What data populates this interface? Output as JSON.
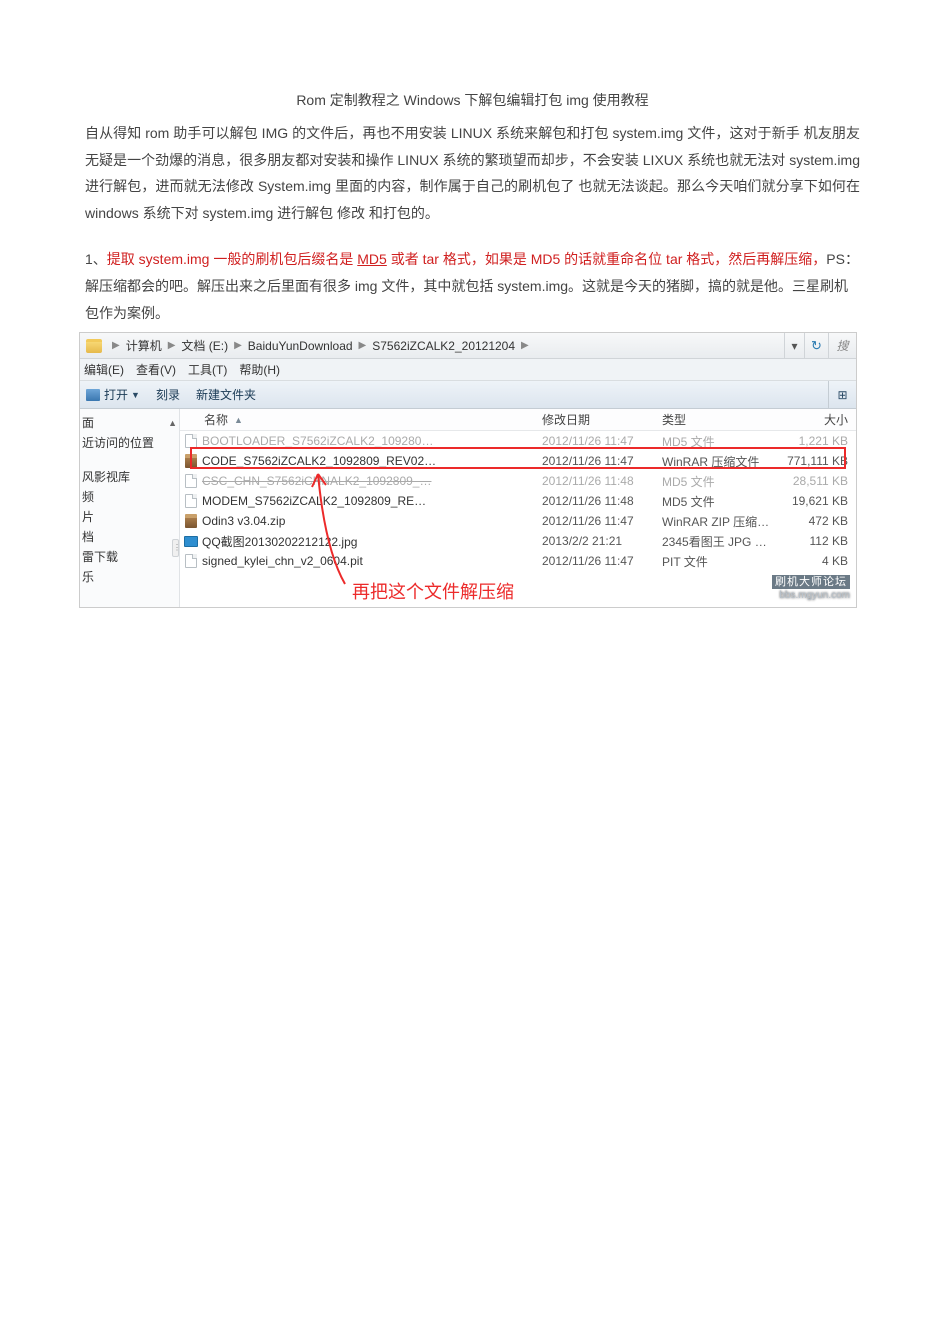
{
  "title": "Rom 定制教程之 Windows 下解包编辑打包 img 使用教程",
  "intro": "自从得知 rom 助手可以解包 IMG 的文件后，再也不用安装 LINUX 系统来解包和打包 system.img 文件，这对于新手 机友朋友无疑是一个劲爆的消息，很多朋友都对安装和操作 LINUX 系统的繁琐望而却步，不会安装 LIXUX 系统也就无法对 system.img 进行解包，进而就无法修改 System.img 里面的内容，制作属于自己的刷机包了 也就无法谈起。那么今天咱们就分享下如何在 windows 系统下对 system.img 进行解包 修改 和打包的。",
  "step1": {
    "prefix": "1、",
    "red_a": "提取 system.img 一般的刷机包后缀名是 ",
    "md5": "MD5",
    "red_b": " 或者 tar 格式，如果是 MD5 的话就重命名位 tar 格式，然后再解压缩，",
    "rest": "PS：解压缩都会的吧。解压出来之后里面有很多 img 文件，其中就包括 system.img。这就是今天的猪脚，搞的就是他。三星刷机包作为案例。"
  },
  "explorer": {
    "breadcrumbs": [
      "计算机",
      "文档 (E:)",
      "BaiduYunDownload",
      "S7562iZCALK2_20121204"
    ],
    "search_placeholder": "搜",
    "menu": {
      "edit": "编辑(E)",
      "view": "查看(V)",
      "tools": "工具(T)",
      "help": "帮助(H)"
    },
    "toolbar": {
      "open": "打开",
      "burn": "刻录",
      "newfolder": "新建文件夹",
      "view_glyph": "⊞"
    },
    "sidebar": {
      "top": "面",
      "recent": "近访问的位置",
      "items": [
        "风影视库",
        "频",
        "片",
        "档",
        "雷下载",
        "乐"
      ]
    },
    "columns": {
      "name": "名称",
      "date": "修改日期",
      "type": "类型",
      "size": "大小"
    },
    "files": [
      {
        "icon": "blank",
        "name": "BOOTLOADER_S7562iZCALK2_109280…",
        "date": "2012/11/26 11:47",
        "type": "MD5 文件",
        "size": "1,221 KB",
        "dim": true
      },
      {
        "icon": "rar",
        "name": "CODE_S7562iZCALK2_1092809_REV02…",
        "date": "2012/11/26 11:47",
        "type": "WinRAR 压缩文件",
        "size": "771,111 KB",
        "dim": false,
        "highlight": true
      },
      {
        "icon": "blank",
        "name": "CSC_CHN_S7562iCHNALK2_1092809_…",
        "date": "2012/11/26 11:48",
        "type": "MD5 文件",
        "size": "28,511 KB",
        "dim": true,
        "strike": true
      },
      {
        "icon": "blank",
        "name": "MODEM_S7562iZCALK2_1092809_RE…",
        "date": "2012/11/26 11:48",
        "type": "MD5 文件",
        "size": "19,621 KB",
        "dim": false
      },
      {
        "icon": "zip",
        "name": "Odin3 v3.04.zip",
        "date": "2012/11/26 11:47",
        "type": "WinRAR ZIP 压缩…",
        "size": "472 KB",
        "dim": false
      },
      {
        "icon": "img",
        "name": "QQ截图20130202212122.jpg",
        "date": "2013/2/2 21:21",
        "type": "2345看图王 JPG …",
        "size": "112 KB",
        "dim": false
      },
      {
        "icon": "blank",
        "name": "signed_kylei_chn_v2_0604.pit",
        "date": "2012/11/26 11:47",
        "type": "PIT 文件",
        "size": "4 KB",
        "dim": false
      }
    ],
    "annotation": "再把这个文件解压缩",
    "watermark": {
      "line1": "刷机大师论坛",
      "line2": "bbs.mgyun.com"
    }
  }
}
